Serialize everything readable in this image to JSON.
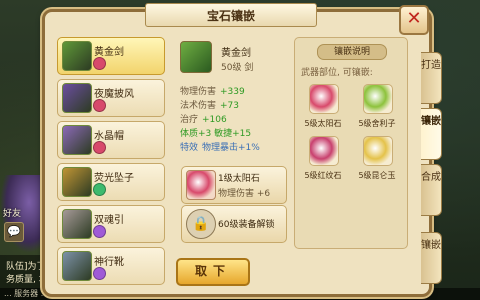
{
  "window": {
    "title": "宝石镶嵌",
    "close_label": "✕"
  },
  "equipment_list": [
    {
      "name": "黄金剑",
      "gem_color": "#d8496b",
      "icon_color": "#5f9838",
      "selected": true
    },
    {
      "name": "夜魔披风",
      "gem_color": "#d8496b",
      "icon_color": "#6b4ea0",
      "selected": false
    },
    {
      "name": "水晶帽",
      "gem_color": "#d8496b",
      "icon_color": "#8c6ab8",
      "selected": false
    },
    {
      "name": "荧光坠子",
      "gem_color": "#3dba6e",
      "icon_color": "#c09535",
      "selected": false
    },
    {
      "name": "双魂引",
      "gem_color": "#9f5ad6",
      "icon_color": "#a69a98",
      "selected": false
    },
    {
      "name": "神行靴",
      "gem_color": "#9f5ad6",
      "icon_color": "#7d92a8",
      "selected": false
    }
  ],
  "detail": {
    "name": "黄金剑",
    "level_text": "50级 剑",
    "stats": [
      {
        "label": "物理伤害",
        "value": "+339"
      },
      {
        "label": "法术伤害",
        "value": "+73"
      },
      {
        "label": "治疗",
        "value": "+106"
      }
    ],
    "extra_stats": "体质+3 敏捷+15",
    "special_label": "特效",
    "special_value": "物理暴击+1%"
  },
  "sockets": [
    {
      "name": "1级太阳石",
      "sub": "物理伤害 +6",
      "type": "gem"
    },
    {
      "name": "60级装备解锁",
      "sub": "",
      "type": "locked"
    }
  ],
  "remove_button": "取下",
  "inlay_info": {
    "header": "镶嵌说明",
    "subtitle": "武器部位, 可镶嵌:",
    "gems": [
      {
        "name": "5级太阳石",
        "color": "#d8496b"
      },
      {
        "name": "5级舍利子",
        "color": "#8dc23c"
      },
      {
        "name": "5级红纹石",
        "color": "#c8406e"
      },
      {
        "name": "5级昆仑玉",
        "color": "#e4c24a"
      }
    ]
  },
  "side_tabs": [
    {
      "label": "打造",
      "active": false
    },
    {
      "label": "镶嵌",
      "active": true
    },
    {
      "label": "合成",
      "active": false
    },
    {
      "label": "镶嵌",
      "active": false
    }
  ],
  "background": {
    "friend_label": "好友",
    "chat_lines": [
      "队伍]为了",
      "务质量, 本"
    ],
    "ticker": "... 服务器 ... ..."
  }
}
